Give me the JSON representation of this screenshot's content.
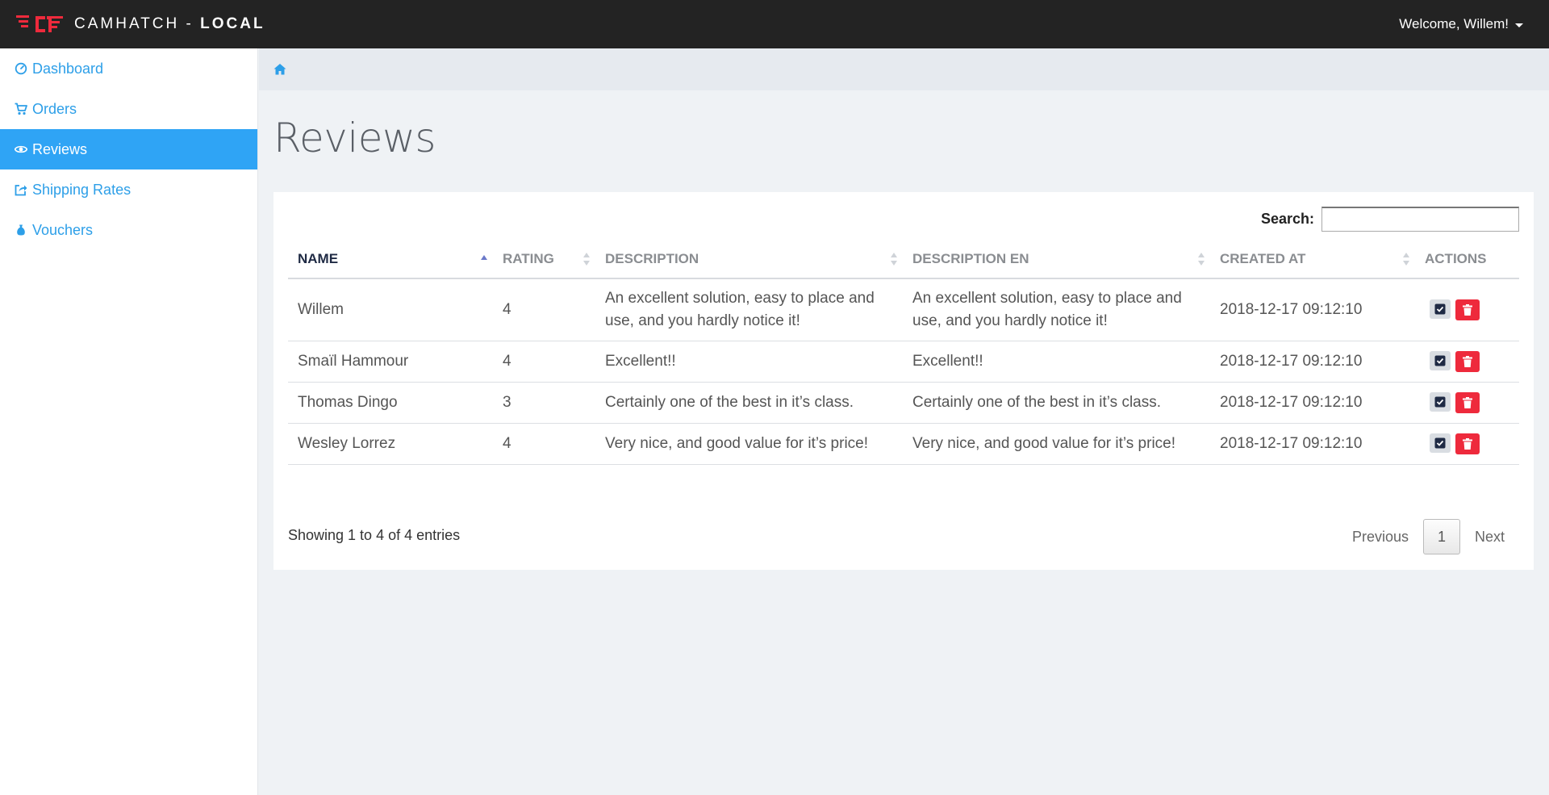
{
  "app": {
    "brand_name": "CAMHATCH - ",
    "brand_env": "LOCAL",
    "welcome": "Welcome, Willem!",
    "brand_color": "#ee2a3c"
  },
  "sidebar": {
    "items": [
      {
        "label": "Dashboard",
        "icon": "dashboard-icon",
        "active": false
      },
      {
        "label": "Orders",
        "icon": "cart-icon",
        "active": false
      },
      {
        "label": "Reviews",
        "icon": "eye-icon",
        "active": true
      },
      {
        "label": "Shipping Rates",
        "icon": "share-icon",
        "active": false
      },
      {
        "label": "Vouchers",
        "icon": "money-bag-icon",
        "active": false
      }
    ],
    "active_color": "#2fa4f5"
  },
  "breadcrumb": {
    "icon": "home-icon"
  },
  "page": {
    "title": "Reviews"
  },
  "table": {
    "search_label": "Search:",
    "search_value": "",
    "columns": [
      "NAME",
      "RATING",
      "DESCRIPTION",
      "DESCRIPTION EN",
      "CREATED AT",
      "ACTIONS"
    ],
    "sorted_column": "NAME",
    "rows": [
      {
        "name": "Willem",
        "rating": "4",
        "description": "An excellent solution, easy to place and use, and you hardly notice it!",
        "description_en": "An excellent solution, easy to place and use, and you hardly notice it!",
        "created_at": "2018-12-17 09:12:10"
      },
      {
        "name": "Smaïl Hammour",
        "rating": "4",
        "description": "Excellent!!",
        "description_en": "Excellent!!",
        "created_at": "2018-12-17 09:12:10"
      },
      {
        "name": "Thomas Dingo",
        "rating": "3",
        "description": "Certainly one of the best in it’s class.",
        "description_en": "Certainly one of the best in it’s class.",
        "created_at": "2018-12-17 09:12:10"
      },
      {
        "name": "Wesley Lorrez",
        "rating": "4",
        "description": "Very nice, and good value for it’s price!",
        "description_en": "Very nice, and good value for it’s price!",
        "created_at": "2018-12-17 09:12:10"
      }
    ],
    "info": "Showing 1 to 4 of 4 entries",
    "pager": {
      "previous": "Previous",
      "current_page": "1",
      "next": "Next"
    }
  }
}
